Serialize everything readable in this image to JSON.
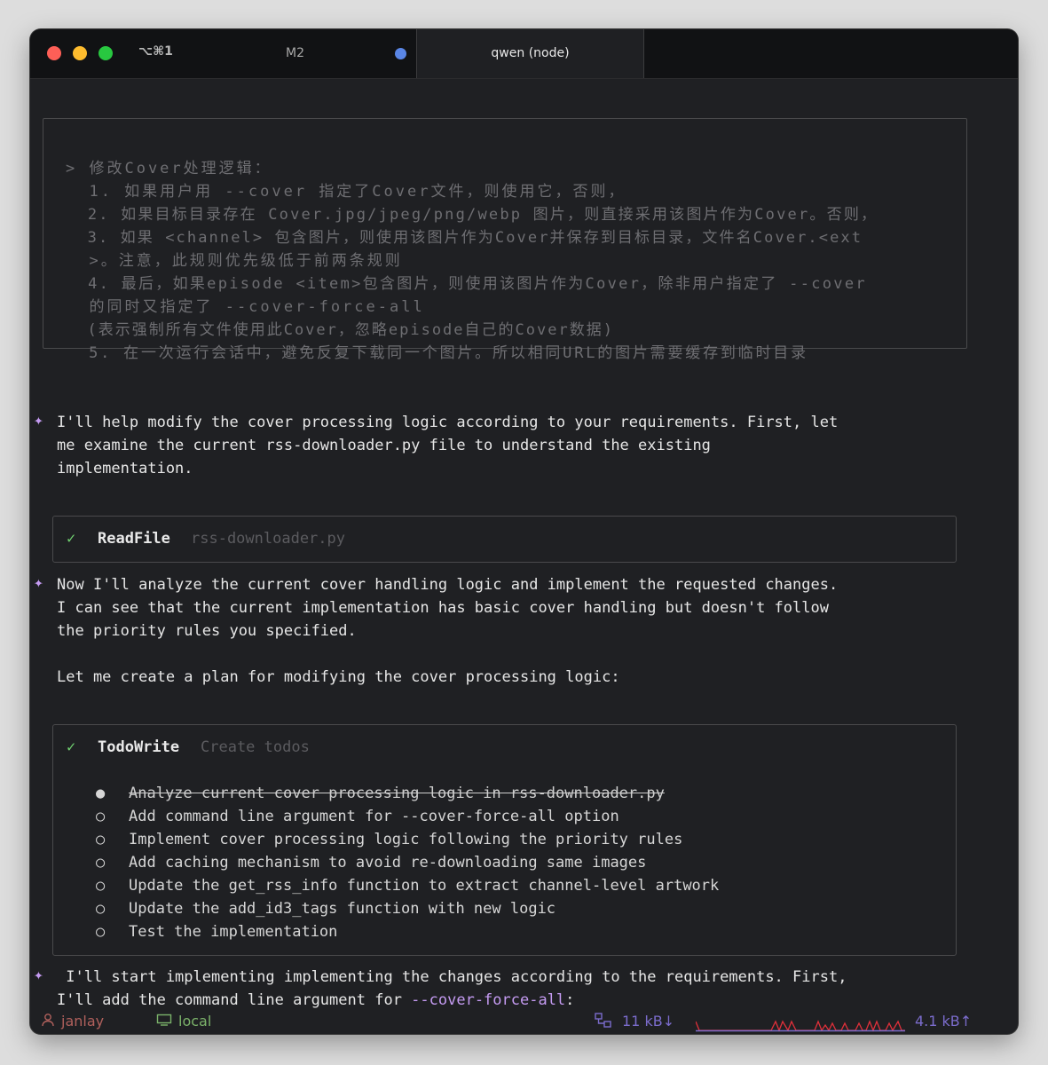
{
  "titlebar": {
    "shortcut": "⌥⌘1",
    "tab_inactive": "M2",
    "tab_active": "qwen (node)"
  },
  "prompt": {
    "lines": [
      "> 修改Cover处理逻辑：",
      "  1. 如果用户用 --cover 指定了Cover文件，则使用它，否则，",
      "  2. 如果目标目录存在 Cover.jpg/jpeg/png/webp 图片，则直接采用该图片作为Cover。否则，",
      "  3. 如果 <channel> 包含图片，则使用该图片作为Cover并保存到目标目录，文件名Cover.<ext",
      "  >。注意，此规则优先级低于前两条规则",
      "  4. 最后，如果episode <item>包含图片，则使用该图片作为Cover，除非用户指定了 --cover",
      "  的同时又指定了 --cover-force-all",
      "  (表示强制所有文件使用此Cover，忽略episode自己的Cover数据)",
      "  5. 在一次运行会话中，避免反复下载同一个图片。所以相同URL的图片需要缓存到临时目录"
    ]
  },
  "messages": {
    "m1": [
      "I'll help modify the cover processing logic according to your requirements. First, let",
      "me examine the current rss-downloader.py file to understand the existing",
      "implementation."
    ],
    "m2": [
      "Now I'll analyze the current cover handling logic and implement the requested changes.",
      "I can see that the current implementation has basic cover handling but doesn't follow",
      "the priority rules you specified."
    ],
    "m2b": "Let me create a plan for modifying the cover processing logic:",
    "m3_line1": " I'll start implementing implementing the changes according to the requirements. First,",
    "m3_line2_prefix": "I'll add the command line argument for ",
    "m3_line2_flag": "--cover-force-all",
    "m3_line2_suffix": ":"
  },
  "tool_readfile": {
    "check": "✓",
    "name": "ReadFile",
    "arg": "rss-downloader.py"
  },
  "tool_todowrite": {
    "check": "✓",
    "name": "TodoWrite",
    "arg": "Create todos",
    "todos": [
      {
        "status": "●",
        "text": "Analyze current cover processing logic in rss-downloader.py"
      },
      {
        "status": "○",
        "text": "Add command line argument for --cover-force-all option"
      },
      {
        "status": "○",
        "text": "Implement cover processing logic following the priority rules"
      },
      {
        "status": "○",
        "text": "Add caching mechanism to avoid re-downloading same images"
      },
      {
        "status": "○",
        "text": "Update the get_rss_info function to extract channel-level artwork"
      },
      {
        "status": "○",
        "text": "Update the add_id3_tags function with new logic"
      },
      {
        "status": "○",
        "text": "Test the implementation"
      }
    ]
  },
  "spark_icon": "✦",
  "statusbar": {
    "user": "janlay",
    "host": "local",
    "down": "11 kB↓",
    "up": "4.1 kB↑",
    "colors": {
      "user": "#b0605c",
      "host": "#7bb26a",
      "net": "#7b6ccc",
      "graph_hi": "#e0303a"
    }
  }
}
